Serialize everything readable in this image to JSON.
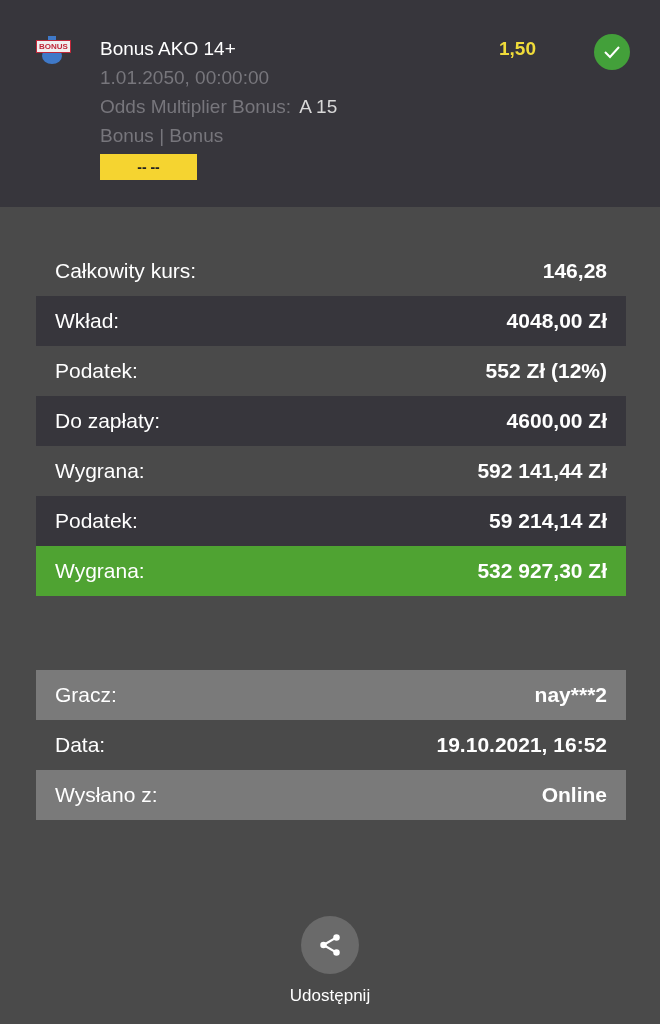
{
  "bet": {
    "icon_label": "BONUS",
    "title": "Bonus AKO 14+",
    "date": "1.01.2050, 00:00:00",
    "market_label": "Odds Multiplier Bonus:",
    "market_value": "A 15",
    "category": "Bonus | Bonus",
    "score": "-- --",
    "odds": "1,50",
    "won": true
  },
  "summary": [
    {
      "label": "Całkowity kurs:",
      "value": "146,28",
      "kind": "plain"
    },
    {
      "label": "Wkład:",
      "value": "4048,00 Zł",
      "kind": "dark"
    },
    {
      "label": "Podatek:",
      "value": "552 Zł (12%)",
      "kind": "plain"
    },
    {
      "label": "Do zapłaty:",
      "value": "4600,00 Zł",
      "kind": "dark"
    },
    {
      "label": "Wygrana:",
      "value": "592 141,44 Zł",
      "kind": "plain"
    },
    {
      "label": "Podatek:",
      "value": "59 214,14 Zł",
      "kind": "dark"
    },
    {
      "label": "Wygrana:",
      "value": "532 927,30 Zł",
      "kind": "green"
    }
  ],
  "details": [
    {
      "label": "Gracz:",
      "value": "nay***2",
      "kind": "light"
    },
    {
      "label": "Data:",
      "value": "19.10.2021, 16:52",
      "kind": "plain"
    },
    {
      "label": "Wysłano z:",
      "value": "Online",
      "kind": "light"
    }
  ],
  "share": {
    "label": "Udostępnij"
  }
}
